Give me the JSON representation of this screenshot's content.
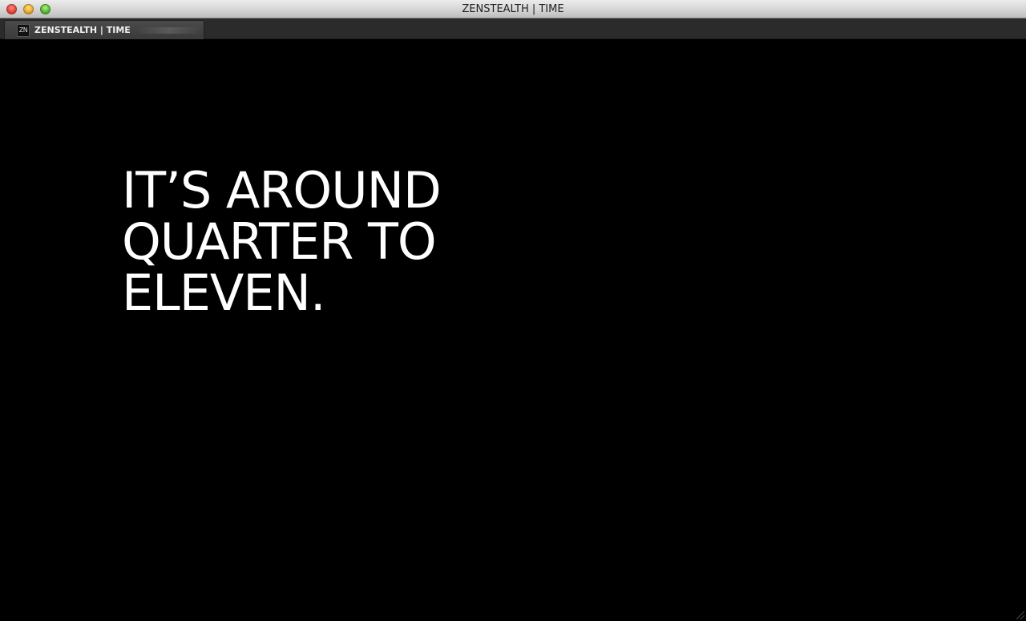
{
  "window": {
    "title": "ZENSTEALTH | TIME"
  },
  "tab": {
    "favicon_text": "ZN",
    "label": "ZENSTEALTH | TIME"
  },
  "main": {
    "time_line_1": "IT’S AROUND",
    "time_line_2": "QUARTER TO",
    "time_line_3": "ELEVEN."
  },
  "colors": {
    "background": "#000000",
    "text": "#ffffff"
  },
  "icons": [
    "close-window-icon",
    "minimize-window-icon",
    "maximize-window-icon",
    "zenstealth-favicon-icon",
    "resize-grip-icon"
  ]
}
